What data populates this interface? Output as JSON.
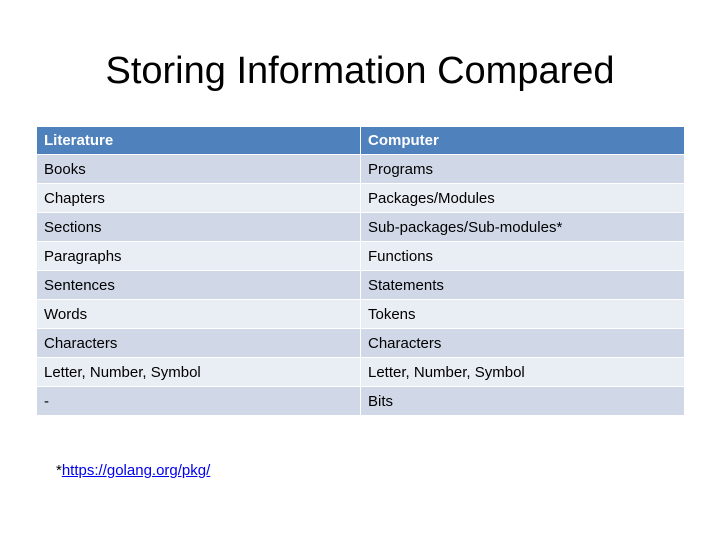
{
  "slide": {
    "title": "Storing Information Compared"
  },
  "table": {
    "headers": [
      "Literature",
      "Computer"
    ],
    "rows": [
      [
        "Books",
        "Programs"
      ],
      [
        "Chapters",
        "Packages/Modules"
      ],
      [
        "Sections",
        "Sub-packages/Sub-modules*"
      ],
      [
        "Paragraphs",
        "Functions"
      ],
      [
        "Sentences",
        "Statements"
      ],
      [
        "Words",
        "Tokens"
      ],
      [
        "Characters",
        "Characters"
      ],
      [
        "Letter, Number, Symbol",
        "Letter, Number, Symbol"
      ],
      [
        "-",
        "Bits"
      ]
    ]
  },
  "footnote": {
    "marker": "*",
    "link_text": "https://golang.org/pkg/"
  },
  "colors": {
    "header_bg": "#4f81bd",
    "row_odd_bg": "#d0d8e8",
    "row_even_bg": "#e9edf4",
    "link": "#0000ee"
  }
}
